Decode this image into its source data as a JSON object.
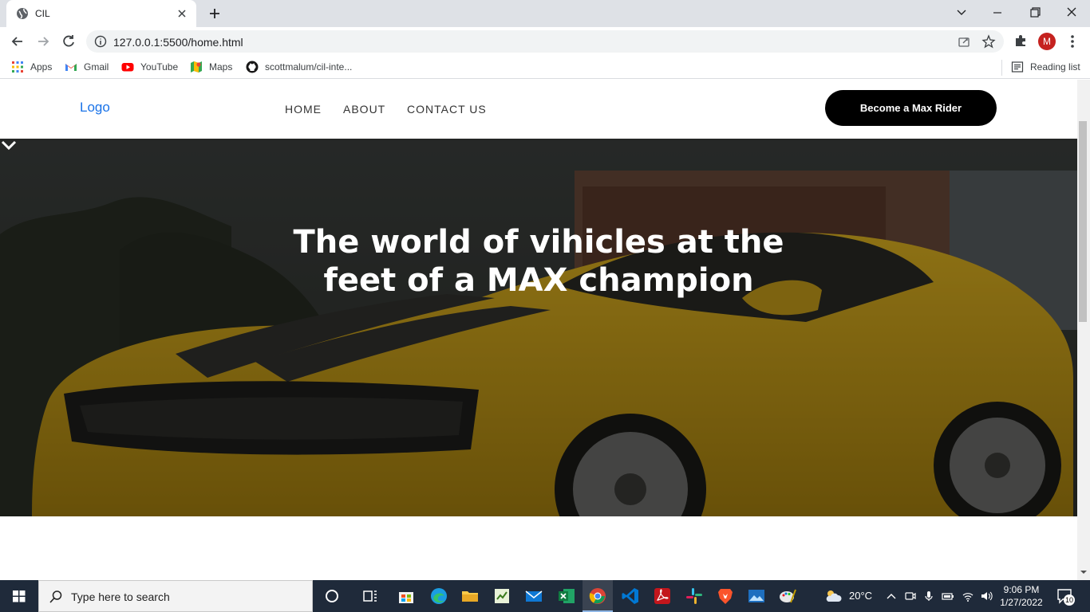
{
  "browser": {
    "tab_title": "CIL",
    "url": "127.0.0.1:5500/home.html",
    "profile_initial": "M",
    "bookmarks": [
      {
        "label": "Apps",
        "icon": "apps-grid-icon"
      },
      {
        "label": "Gmail",
        "icon": "gmail-icon"
      },
      {
        "label": "YouTube",
        "icon": "youtube-icon"
      },
      {
        "label": "Maps",
        "icon": "maps-icon"
      },
      {
        "label": "scottmalum/cil-inte...",
        "icon": "github-icon"
      }
    ],
    "reading_list": "Reading list"
  },
  "site": {
    "logo_alt": "Logo",
    "nav": [
      "HOME",
      "ABOUT",
      "CONTACT US"
    ],
    "cta": "Become a Max Rider",
    "hero_line1": "The world of vihicles at the",
    "hero_line2": "feet of a MAX champion"
  },
  "taskbar": {
    "search_placeholder": "Type here to search",
    "temperature": "20°C",
    "time": "9:06 PM",
    "date": "1/27/2022",
    "notification_count": "10"
  },
  "colors": {
    "accent": "#1a73e8",
    "cta_bg": "#000000",
    "car_yellow": "#e0b420",
    "taskbar": "#1f2a3a"
  }
}
